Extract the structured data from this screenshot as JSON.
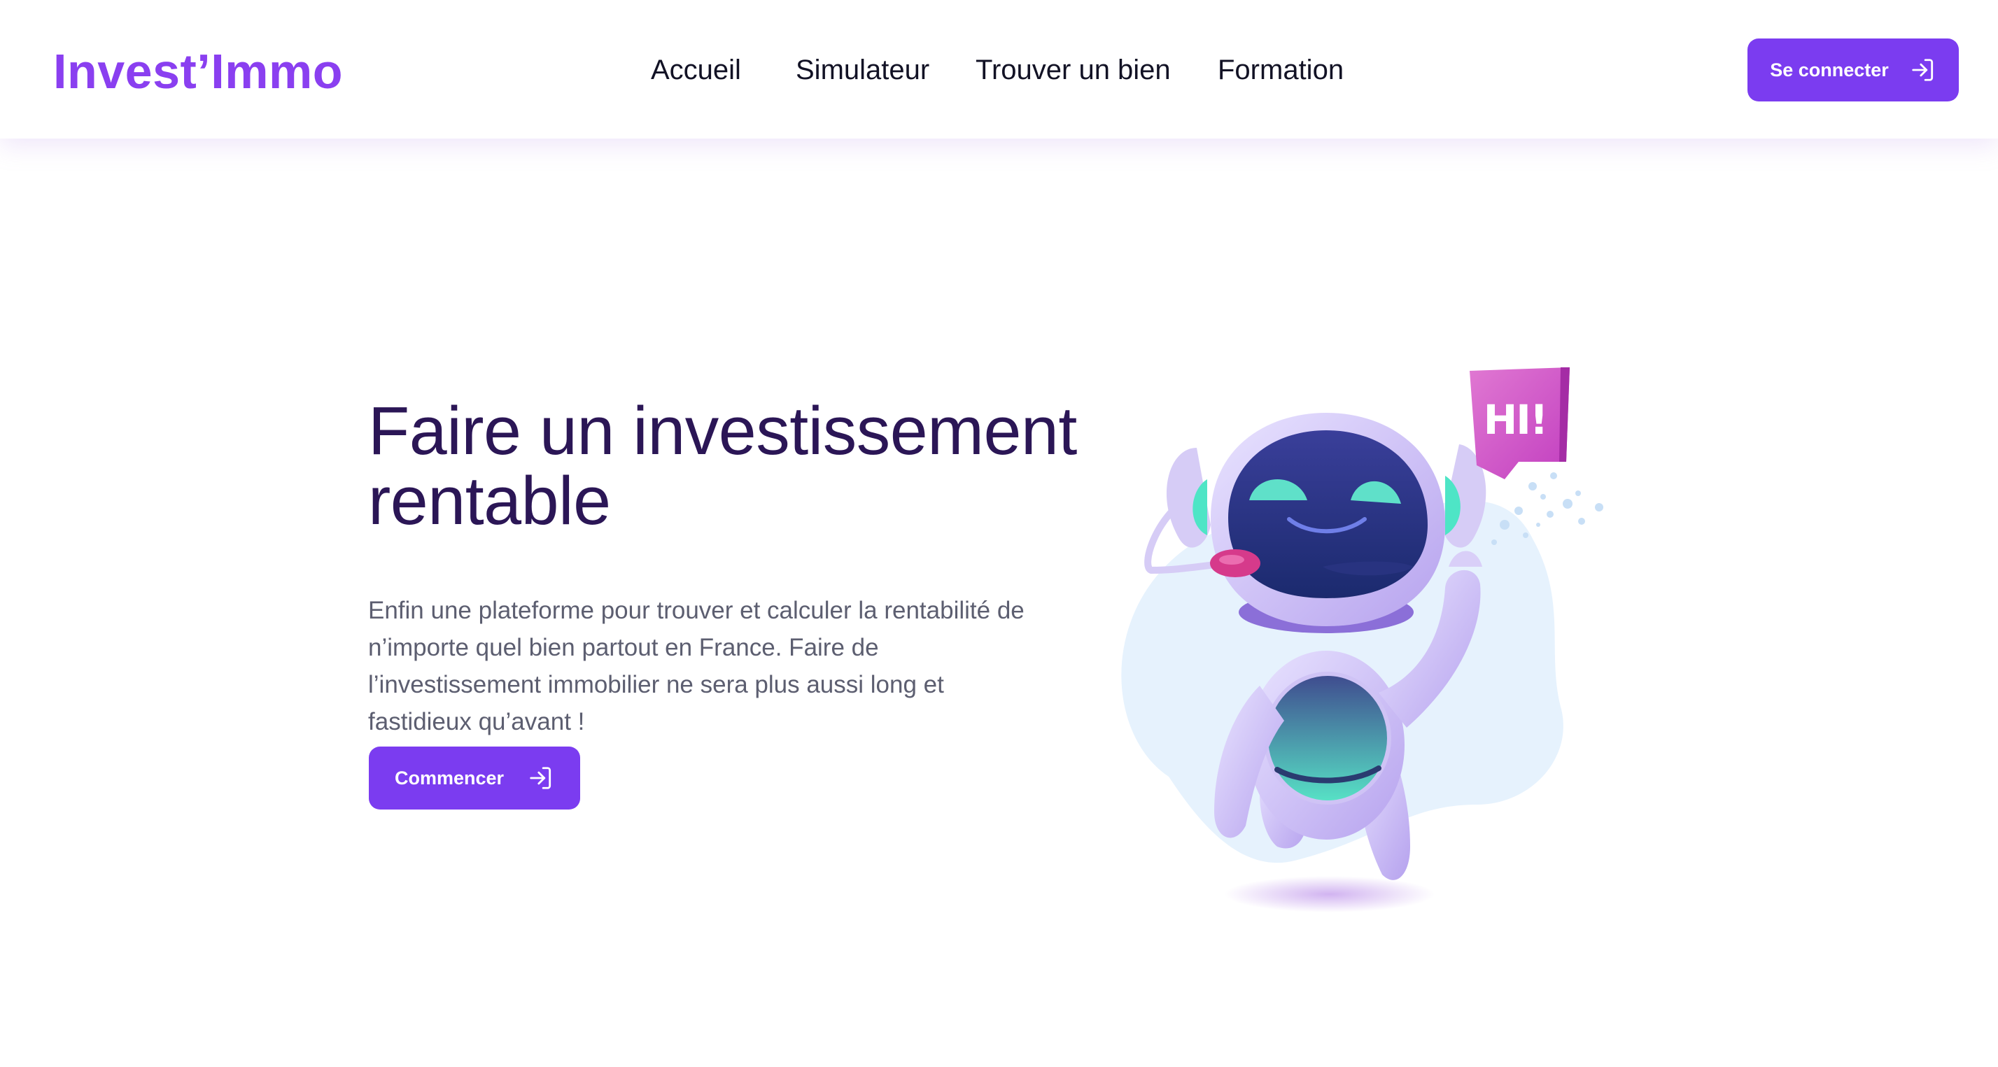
{
  "header": {
    "logo": "Invest’Immo",
    "nav": [
      {
        "label": "Accueil"
      },
      {
        "label": "Simulateur"
      },
      {
        "label": "Trouver un bien"
      },
      {
        "label": "Formation"
      }
    ],
    "login_label": "Se connecter"
  },
  "hero": {
    "title": "Faire un investissement rentable",
    "description": "Enfin une plateforme pour trouver et calculer la rentabilité de n’importe quel bien partout en France. Faire de l’investissement immobilier ne sera plus aussi long et fastidieux qu’avant !",
    "cta_label": "Commencer",
    "illustration": {
      "name": "robot-waving-illustration",
      "bubble_text": "HI!"
    }
  },
  "colors": {
    "brand": "#8a3ff0",
    "button": "#7b3cf0",
    "title": "#2b1656",
    "body_text": "#5c5e70",
    "nav_text": "#121225"
  },
  "icons": {
    "login": "login-arrow-icon",
    "cta": "login-arrow-icon"
  }
}
